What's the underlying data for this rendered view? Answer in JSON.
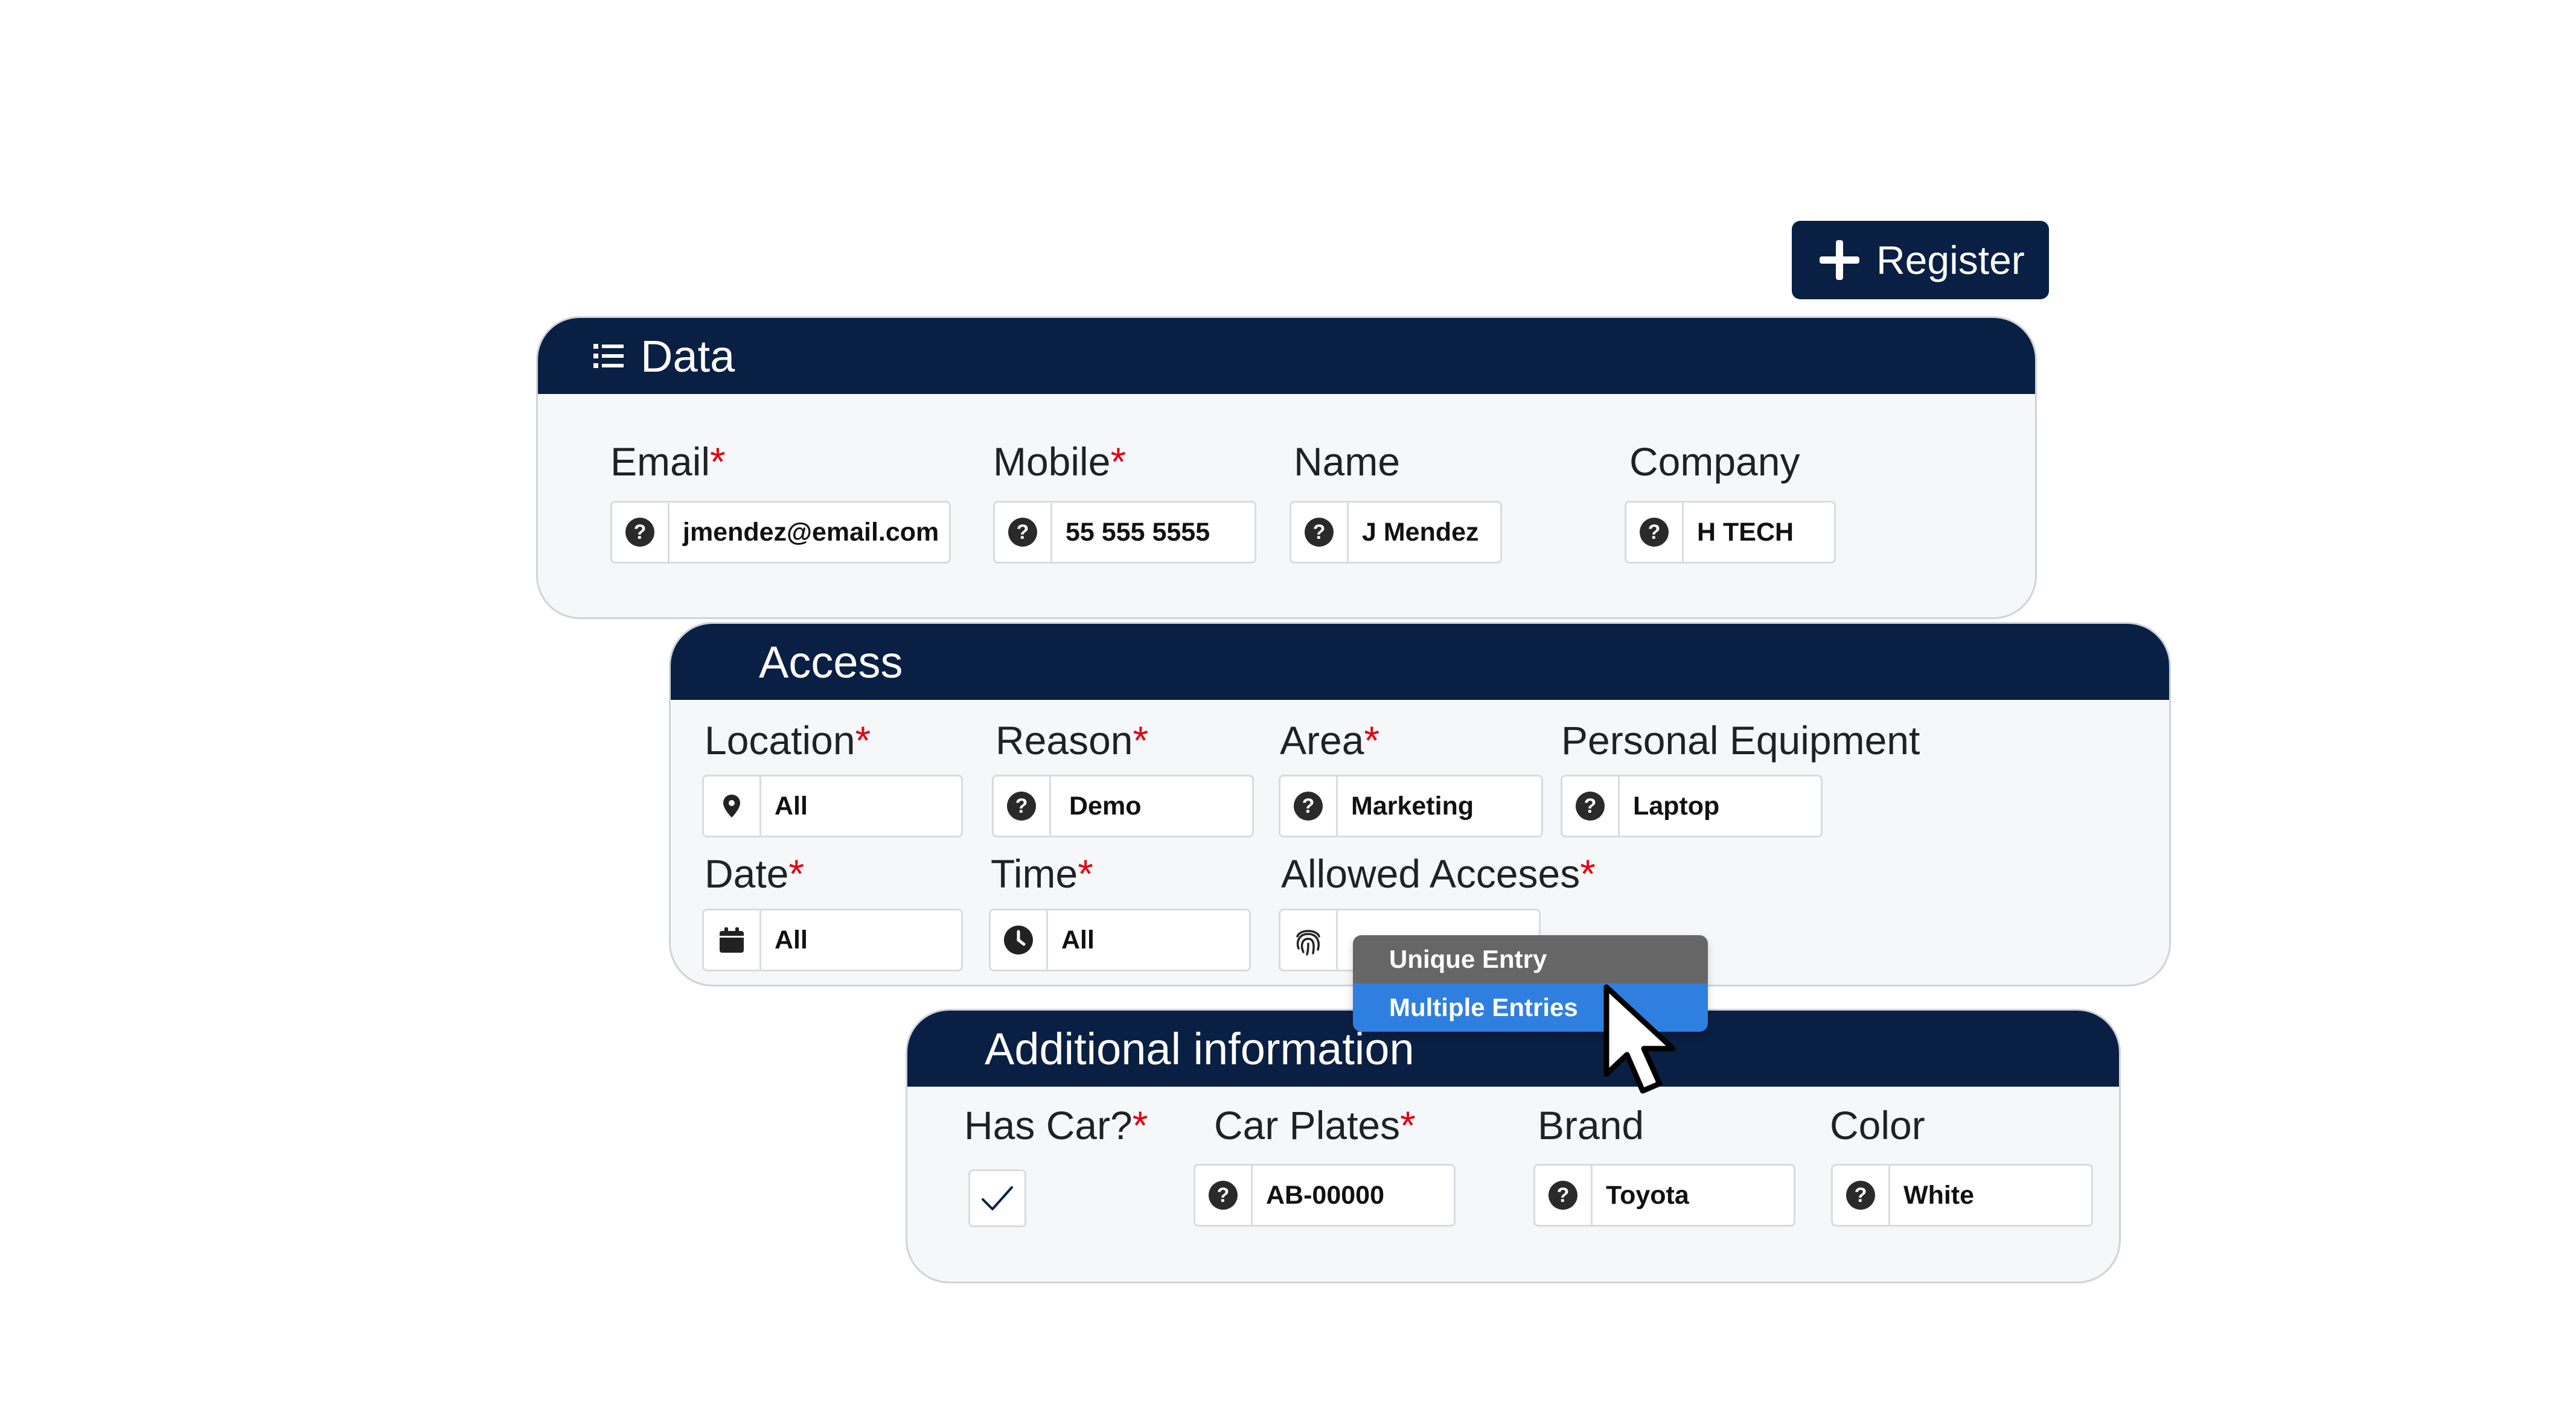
{
  "register": {
    "label": "Register"
  },
  "data_section": {
    "title": "Data",
    "email": {
      "label": "Email",
      "value": "jmendez@email.com"
    },
    "mobile": {
      "label": "Mobile",
      "value": "55 555 5555"
    },
    "name": {
      "label": "Name",
      "value": "J Mendez"
    },
    "company": {
      "label": "Company",
      "value": "H TECH"
    }
  },
  "access_section": {
    "title": "Access",
    "location": {
      "label": "Location",
      "value": "All"
    },
    "reason": {
      "label": "Reason",
      "value": "Demo"
    },
    "area": {
      "label": "Area",
      "value": "Marketing"
    },
    "personal_equipment": {
      "label": "Personal Equipment",
      "value": "Laptop"
    },
    "date": {
      "label": "Date",
      "value": "All"
    },
    "time": {
      "label": "Time",
      "value": "All"
    },
    "allowed_accesses": {
      "label": "Allowed Acceses",
      "options": [
        "Unique Entry",
        "Multiple Entries"
      ],
      "highlighted": "Multiple Entries"
    }
  },
  "additional_section": {
    "title": "Additional information",
    "has_car": {
      "label": "Has Car?",
      "checked": true
    },
    "car_plates": {
      "label": "Car Plates",
      "value": "AB-00000"
    },
    "brand": {
      "label": "Brand",
      "value": "Toyota"
    },
    "color": {
      "label": "Color",
      "value": "White"
    }
  },
  "required_marker": "*",
  "colors": {
    "header_navy": "#0a1f44",
    "required_red": "#e3000f",
    "dropdown_highlight": "#2f7fe0",
    "dropdown_item": "#666666"
  },
  "icons": {
    "field_help": "question-circle-icon",
    "location": "map-pin-icon",
    "date": "calendar-icon",
    "time": "clock-icon",
    "allowed_accesses": "fingerprint-icon",
    "header_data": "list-icon",
    "register": "plus-icon",
    "cursor": "mouse-pointer-icon"
  }
}
